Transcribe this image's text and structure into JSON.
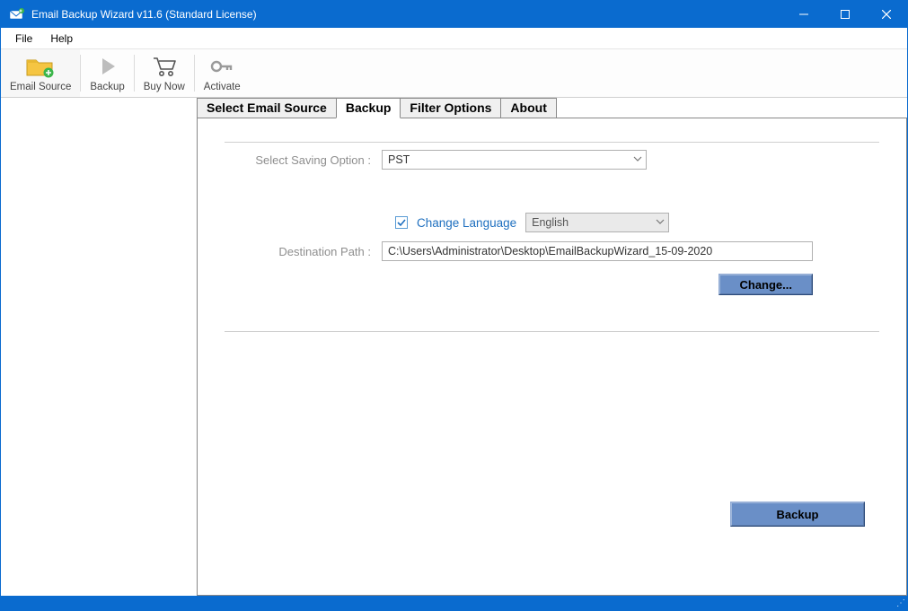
{
  "window": {
    "title": "Email Backup Wizard v11.6 (Standard License)"
  },
  "menubar": {
    "file": "File",
    "help": "Help"
  },
  "toolbar": {
    "email_source": "Email Source",
    "backup": "Backup",
    "buy_now": "Buy Now",
    "activate": "Activate"
  },
  "tabs": {
    "select_email_source": "Select Email Source",
    "backup": "Backup",
    "filter_options": "Filter Options",
    "about": "About"
  },
  "form": {
    "saving_option_label": "Select Saving Option :",
    "saving_option_value": "PST",
    "change_language_label": "Change Language",
    "change_language_checked": true,
    "language_value": "English",
    "destination_path_label": "Destination Path :",
    "destination_path_value": "C:\\Users\\Administrator\\Desktop\\EmailBackupWizard_15-09-2020",
    "change_button": "Change...",
    "backup_button": "Backup"
  }
}
